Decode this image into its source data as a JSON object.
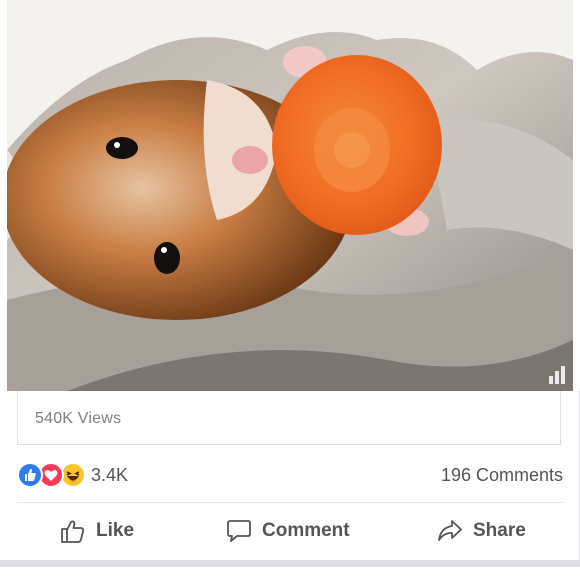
{
  "video": {
    "description_icon": "play-stats-icon"
  },
  "stats": {
    "views_label": "540K Views",
    "reaction_count": "3.4K",
    "comments_label": "196 Comments",
    "reaction_icons": [
      "like-reaction-icon",
      "love-reaction-icon",
      "haha-reaction-icon"
    ]
  },
  "actions": {
    "like_label": "Like",
    "comment_label": "Comment",
    "share_label": "Share"
  },
  "colors": {
    "like_blue": "#2e7bf2",
    "love_red": "#f23a5a",
    "haha_yellow": "#f7c52c",
    "text_gray": "#555555"
  }
}
